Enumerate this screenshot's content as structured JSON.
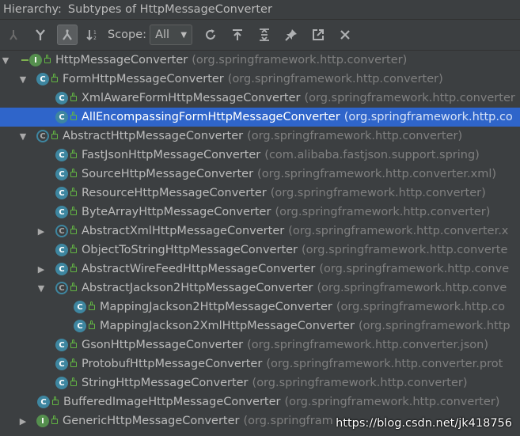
{
  "title": {
    "label": "Hierarchy:",
    "text": "Subtypes of HttpMessageConverter"
  },
  "toolbar": {
    "scope_label": "Scope:",
    "scope_value": "All",
    "buttons": [
      "type-hierarchy-icon",
      "supertypes-icon",
      "subtypes-icon",
      "sort-alpha-icon",
      "refresh-icon",
      "export-icon",
      "expand-all-icon",
      "pin-icon",
      "open-in-new-icon",
      "close-icon"
    ]
  },
  "tree": [
    {
      "name": "HttpMessageConverter",
      "pkg": "(org.springframework.http.converter)",
      "icon": "I",
      "kind": "iface",
      "arrow": "▼"
    },
    {
      "name": "FormHttpMessageConverter",
      "pkg": "(org.springframework.http.converter)",
      "icon": "C",
      "kind": "class",
      "arrow": "▼"
    },
    {
      "name": "XmlAwareFormHttpMessageConverter",
      "pkg": "(org.springframework.http.converter",
      "icon": "C",
      "kind": "class",
      "arrow": ""
    },
    {
      "name": "AllEncompassingFormHttpMessageConverter",
      "pkg": "(org.springframework.http.co",
      "icon": "C",
      "kind": "class",
      "arrow": "",
      "selected": true
    },
    {
      "name": "AbstractHttpMessageConverter",
      "pkg": "(org.springframework.http.converter)",
      "icon": "C",
      "kind": "abstract",
      "arrow": "▼"
    },
    {
      "name": "FastJsonHttpMessageConverter",
      "pkg": "(com.alibaba.fastjson.support.spring)",
      "icon": "C",
      "kind": "class",
      "arrow": ""
    },
    {
      "name": "SourceHttpMessageConverter",
      "pkg": "(org.springframework.http.converter.xml)",
      "icon": "C",
      "kind": "class",
      "arrow": ""
    },
    {
      "name": "ResourceHttpMessageConverter",
      "pkg": "(org.springframework.http.converter)",
      "icon": "C",
      "kind": "class",
      "arrow": ""
    },
    {
      "name": "ByteArrayHttpMessageConverter",
      "pkg": "(org.springframework.http.converter)",
      "icon": "C",
      "kind": "class",
      "arrow": ""
    },
    {
      "name": "AbstractXmlHttpMessageConverter",
      "pkg": "(org.springframework.http.converter.x",
      "icon": "C",
      "kind": "abstract",
      "arrow": "▶"
    },
    {
      "name": "ObjectToStringHttpMessageConverter",
      "pkg": "(org.springframework.http.converte",
      "icon": "C",
      "kind": "class",
      "arrow": ""
    },
    {
      "name": "AbstractWireFeedHttpMessageConverter",
      "pkg": "(org.springframework.http.conve",
      "icon": "C",
      "kind": "abstract",
      "arrow": "▶"
    },
    {
      "name": "AbstractJackson2HttpMessageConverter",
      "pkg": "(org.springframework.http.conve",
      "icon": "C",
      "kind": "abstract",
      "arrow": "▼"
    },
    {
      "name": "MappingJackson2HttpMessageConverter",
      "pkg": "(org.springframework.http.co",
      "icon": "C",
      "kind": "class",
      "arrow": ""
    },
    {
      "name": "MappingJackson2XmlHttpMessageConverter",
      "pkg": "(org.springframework.http",
      "icon": "C",
      "kind": "class",
      "arrow": ""
    },
    {
      "name": "GsonHttpMessageConverter",
      "pkg": "(org.springframework.http.converter.json)",
      "icon": "C",
      "kind": "class",
      "arrow": ""
    },
    {
      "name": "ProtobufHttpMessageConverter",
      "pkg": "(org.springframework.http.converter.prot",
      "icon": "C",
      "kind": "class",
      "arrow": ""
    },
    {
      "name": "StringHttpMessageConverter",
      "pkg": "(org.springframework.http.converter)",
      "icon": "C",
      "kind": "class",
      "arrow": ""
    },
    {
      "name": "BufferedImageHttpMessageConverter",
      "pkg": "(org.springframework.http.converter)",
      "icon": "C",
      "kind": "class",
      "arrow": ""
    },
    {
      "name": "GenericHttpMessageConverter",
      "pkg": "(org.springfram",
      "icon": "I",
      "kind": "iface",
      "arrow": "▶"
    }
  ],
  "watermark": "https://blog.csdn.net/jk418756",
  "colors": {
    "background": "#3c3f41",
    "selection": "#2f65ca",
    "class_icon": "#3e86a0",
    "interface_icon": "#558f4e",
    "package_text": "#808080"
  }
}
